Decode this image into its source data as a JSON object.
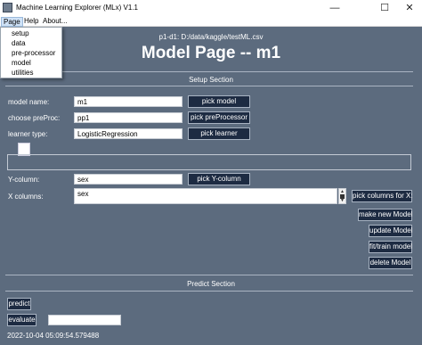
{
  "window": {
    "title": "Machine Learning Explorer (MLx) V1.1",
    "minimize_glyph": "—",
    "maximize_glyph": "☐",
    "close_glyph": "✕"
  },
  "menubar": {
    "page": "Page",
    "help": "Help",
    "about": "About..."
  },
  "page_menu": {
    "items": [
      "setup",
      "data",
      "pre-processor",
      "model",
      "utilities"
    ]
  },
  "header": {
    "filepath": "p1-d1: D:/data/kaggle/testML.csv",
    "title": "Model Page -- m1"
  },
  "setup_section": {
    "title": "Setup Section",
    "model_name_label": "model name:",
    "model_name_value": "m1",
    "pick_model": "pick model",
    "preproc_label": "choose preProc:",
    "preproc_value": "pp1",
    "pick_preproc": "pick preProcessor",
    "learner_label": "learner type:",
    "learner_value": "LogisticRegression",
    "pick_learner": "pick learner",
    "y_label": "Y-column:",
    "y_value": "sex",
    "pick_y": "pick Y-column",
    "x_label": "X columns:",
    "x_value": "sex",
    "pick_x": "pick columns for X:",
    "make_new_model": "make new Model",
    "update_model": "update Model",
    "fit_train_model": "fit/train model",
    "delete_model": "delete Model"
  },
  "predict_section": {
    "title": "Predict Section",
    "predict": "predict",
    "evaluate": "evaluate",
    "evaluate_value": ""
  },
  "status": {
    "timestamp": "2022-10-04 05:09:54.579488"
  },
  "colors": {
    "background": "#5c6b7e",
    "button": "#1d2b42",
    "text": "#ffffff"
  }
}
